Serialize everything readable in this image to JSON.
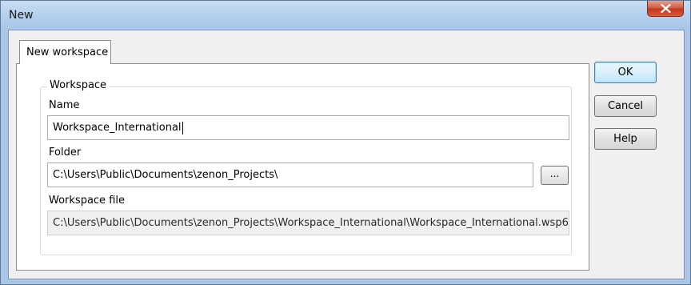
{
  "window": {
    "title": "New"
  },
  "tabs": [
    {
      "label": "New workspace",
      "selected": true
    }
  ],
  "workspace_group": {
    "legend": "Workspace",
    "name_label": "Name",
    "name_value": "Workspace_International",
    "folder_label": "Folder",
    "folder_value": "C:\\Users\\Public\\Documents\\zenon_Projects\\",
    "browse_label": "...",
    "file_label": "Workspace file",
    "file_value": "C:\\Users\\Public\\Documents\\zenon_Projects\\Workspace_International\\Workspace_International.wsp6"
  },
  "buttons": {
    "ok": "OK",
    "cancel": "Cancel",
    "help": "Help"
  },
  "icons": {
    "close": "close-icon"
  },
  "colors": {
    "titlebar": "#b3cfed",
    "close_button": "#c2351c",
    "dialog_bg": "#f0f0f0"
  }
}
